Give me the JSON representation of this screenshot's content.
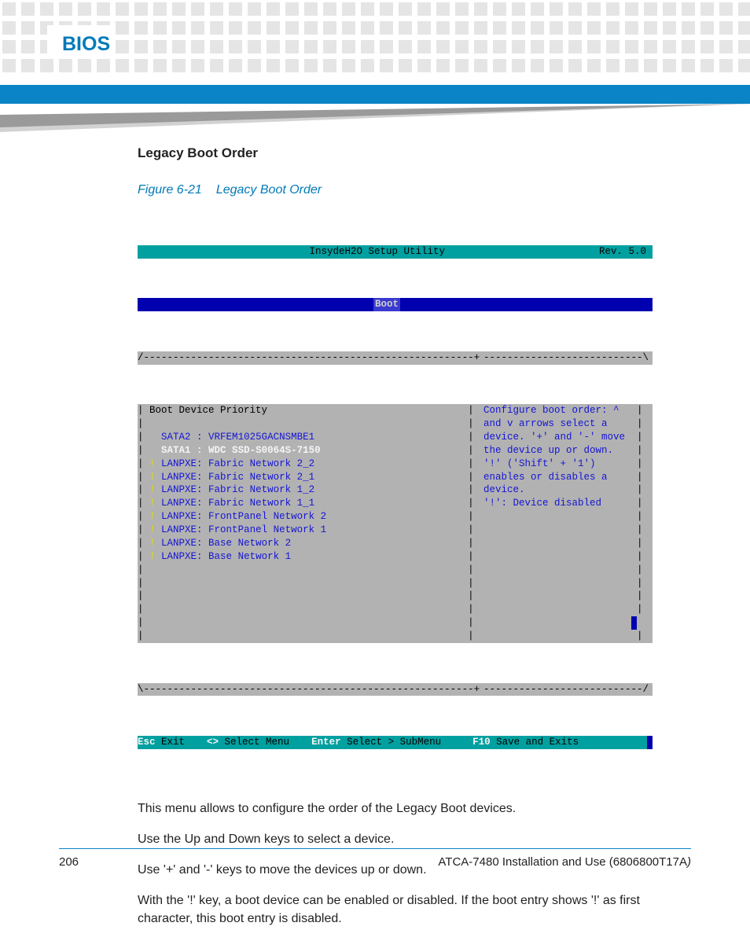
{
  "header": {
    "title": "BIOS"
  },
  "section": {
    "heading": "Legacy Boot Order"
  },
  "figure": {
    "number": "Figure 6-21",
    "title": "Legacy Boot Order"
  },
  "bios": {
    "title_left": "InsydeH2O Setup Utility",
    "title_right": "Rev. 5.0",
    "tab": "Boot",
    "panel_heading": "Boot Device Priority",
    "devices": [
      {
        "prefix": "  ",
        "text": "SATA2 : VRFEM1025GACNSMBE1",
        "style": "blue"
      },
      {
        "prefix": "  ",
        "text": "SATA1 : WDC SSD-S0064S-7150",
        "style": "white"
      },
      {
        "prefix": "! ",
        "text": "LANPXE: Fabric Network 2_2",
        "style": "blue"
      },
      {
        "prefix": "! ",
        "text": "LANPXE: Fabric Network 2_1",
        "style": "blue"
      },
      {
        "prefix": "! ",
        "text": "LANPXE: Fabric Network 1_2",
        "style": "blue"
      },
      {
        "prefix": "! ",
        "text": "LANPXE: Fabric Network 1_1",
        "style": "blue"
      },
      {
        "prefix": "! ",
        "text": "LANPXE: FrontPanel Network 2",
        "style": "blue"
      },
      {
        "prefix": "! ",
        "text": "LANPXE: FrontPanel Network 1",
        "style": "blue"
      },
      {
        "prefix": "! ",
        "text": "LANPXE: Base Network 2",
        "style": "blue"
      },
      {
        "prefix": "! ",
        "text": "LANPXE: Base Network 1",
        "style": "blue"
      }
    ],
    "help": [
      "Configure boot order: ^",
      "and v arrows select a",
      "device. '+' and '-' move",
      "the device up or down.",
      "'!' ('Shift' + '1')",
      "enables or disables a",
      "device.",
      "'!': Device disabled"
    ],
    "footer": {
      "esc_key": "Esc",
      "esc_label": " Exit",
      "arrows": "<>",
      "arrows_label": " Select Menu",
      "enter_key": "Enter",
      "enter_label": " Select > SubMenu",
      "f10_key": "F10",
      "f10_label": " Save and Exits"
    }
  },
  "body": {
    "p1": "This menu allows to configure the order of the  Legacy Boot devices.",
    "p2": "Use the Up and Down keys to select a device.",
    "p3": "Use '+' and '-' keys to move the devices up or down.",
    "p4": "With the '!' key, a boot device can be enabled or disabled. If the boot entry shows '!' as first character, this boot entry is disabled."
  },
  "footer": {
    "page": "206",
    "doc": "ATCA-7480 Installation and Use (6806800T17A",
    "close": ")"
  }
}
